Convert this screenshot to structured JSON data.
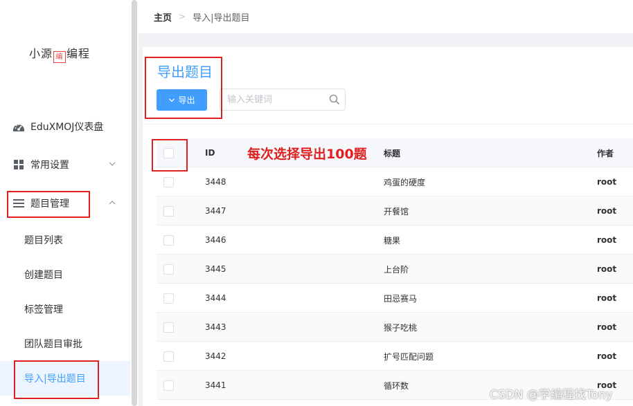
{
  "logo": {
    "text_left": "小源",
    "text_mark": "编",
    "text_right": "编程"
  },
  "sidebar": {
    "items": [
      {
        "label": "EduXMOJ仪表盘",
        "icon": "dashboard-icon"
      },
      {
        "label": "常用设置",
        "icon": "grid-icon",
        "chevron": "chevron-down-icon"
      },
      {
        "label": "题目管理",
        "icon": "menu-lines-icon",
        "chevron": "chevron-up-icon"
      }
    ],
    "subitems": [
      {
        "label": "题目列表"
      },
      {
        "label": "创建题目"
      },
      {
        "label": "标签管理"
      },
      {
        "label": "团队题目审批"
      },
      {
        "label": "导入|导出题目",
        "active": true
      }
    ]
  },
  "breadcrumb": {
    "home": "主页",
    "separator": ">",
    "current": "导入|导出题目"
  },
  "main": {
    "title": "导出题目",
    "export_button": "导出",
    "search_placeholder": "输入关键词",
    "annotation": "每次选择导出100题"
  },
  "table": {
    "columns": [
      "ID",
      "标题",
      "作者"
    ],
    "rows": [
      {
        "id": "3448",
        "title": "鸡蛋的硬度",
        "author": "root"
      },
      {
        "id": "3447",
        "title": "开餐馆",
        "author": "root"
      },
      {
        "id": "3446",
        "title": "糖果",
        "author": "root"
      },
      {
        "id": "3445",
        "title": "上台阶",
        "author": "root"
      },
      {
        "id": "3444",
        "title": "田忌赛马",
        "author": "root"
      },
      {
        "id": "3443",
        "title": "猴子吃桃",
        "author": "root"
      },
      {
        "id": "3442",
        "title": "扩号匹配问题",
        "author": "root"
      },
      {
        "id": "3441",
        "title": "循环数",
        "author": "root"
      }
    ]
  },
  "watermark": "CSDN @学编程找Tony",
  "colors": {
    "primary": "#409eff",
    "annotation_red": "#e02020",
    "active_bg": "#ecf5ff"
  }
}
